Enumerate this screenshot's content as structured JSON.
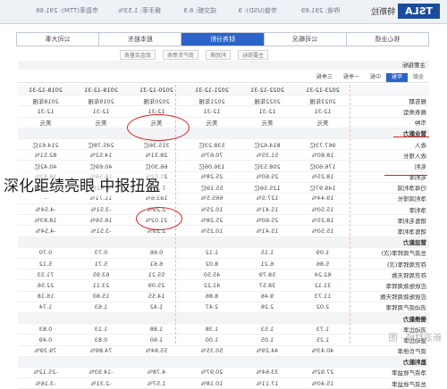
{
  "headline": "深化距绩亮眼 中报扭盈",
  "topbar": {
    "ticker": "TSLA",
    "tag": "特斯拉",
    "stats": [
      "昨收: 291.69",
      "市值(USD): 9",
      "成交额: 8.9",
      "换手率: 1.53%",
      "市盈率(TTM): 291.66"
    ]
  },
  "tabs": [
    "核心业绩",
    "公司概况",
    "财务分析",
    "股本股东",
    "公司大事"
  ],
  "active_tab": 2,
  "subtabs": [
    "主要指标",
    "利润表",
    "资产负债表",
    "现金流量表"
  ],
  "section_title": "主要指标",
  "periods": [
    "全部",
    "年报",
    "中报",
    "一季报",
    "三季报"
  ],
  "active_period": 1,
  "columns": [
    "",
    "2023-12-31",
    "2022-12-31",
    "2021-12-31",
    "2020-12-31",
    "2019-12-31",
    "2018-12-31"
  ],
  "rows": [
    {
      "label": "报告期",
      "values": [
        "2023年报",
        "2022年报",
        "2021年报",
        "2020年报",
        "2019年报",
        "2018年报"
      ]
    },
    {
      "label": "报表类型",
      "values": [
        "12-31",
        "12-31",
        "12-31",
        "12-31",
        "12-31",
        "12-31"
      ]
    },
    {
      "label": "币种",
      "values": [
        "美元",
        "美元",
        "美元",
        "美元",
        "美元",
        "美元"
      ]
    },
    {
      "label": "营业能力",
      "group": true
    },
    {
      "label": "收入",
      "values": [
        "967.73亿",
        "814.62亿",
        "538.23亿",
        "315.36亿",
        "245.78亿",
        "214.61亿"
      ]
    },
    {
      "label": "收入增长",
      "values": [
        "18.80%",
        "51.35%",
        "70.67%",
        "28.31%",
        "14.52%",
        "82.51%"
      ]
    },
    {
      "label": "毛利",
      "values": [
        "176.60亿",
        "208.53亿",
        "136.06亿",
        "66.30亿",
        "40.69亿",
        "40.42亿"
      ]
    },
    {
      "label": "毛利率",
      "values": [
        "18.25%",
        "25.60%",
        "25.28%",
        "21.02%",
        "16.56%",
        "18.83%"
      ]
    },
    {
      "label": "归母净利润",
      "values": [
        "149.97亿",
        "125.56亿",
        "55.19亿",
        "7.21亿",
        "-8.62亿",
        "-9.76亿"
      ]
    },
    {
      "label": "净利润增长",
      "values": [
        "19.44%",
        "127.5%",
        "665.5%",
        "183.6%",
        "11.71%",
        "-"
      ]
    },
    {
      "label": "净利率",
      "values": [
        "15.50%",
        "15.41%",
        "10.25%",
        "2.29%",
        "-3.51%",
        "-4.54%"
      ]
    },
    {
      "label": "销售毛利率",
      "values": [
        "18.25%",
        "25.60%",
        "25.28%",
        "21.02%",
        "16.56%",
        "18.83%"
      ]
    },
    {
      "label": "销售净利率",
      "values": [
        "15.50%",
        "15.41%",
        "10.25%",
        "2.29%",
        "-3.51%",
        "-4.54%"
      ]
    },
    {
      "label": "营运能力",
      "group": true
    },
    {
      "label": "总资产周转率(次)",
      "values": [
        "1.09",
        "1.15",
        "1.12",
        "0.66",
        "0.73",
        "0.70"
      ]
    },
    {
      "label": "存货周转率(次)",
      "values": [
        "5.86",
        "6.21",
        "8.02",
        "6.61",
        "5.71",
        "5.12"
      ]
    },
    {
      "label": "存货周转天数",
      "values": [
        "62.24",
        "58.79",
        "45.50",
        "55.21",
        "63.95",
        "71.33"
      ]
    },
    {
      "label": "应收账款周转率",
      "values": [
        "31.12",
        "38.57",
        "41.22",
        "25.09",
        "23.11",
        "22.56"
      ]
    },
    {
      "label": "应收账款周转天数",
      "values": [
        "11.73",
        "9.46",
        "8.86",
        "14.55",
        "15.80",
        "16.18"
      ]
    },
    {
      "label": "流动资产周转率",
      "values": [
        "2.02",
        "2.26",
        "2.47",
        "1.42",
        "1.63",
        "1.74"
      ]
    },
    {
      "label": "偿债能力",
      "group": true
    },
    {
      "label": "流动比率",
      "values": [
        "1.73",
        "1.53",
        "1.38",
        "1.88",
        "1.13",
        "0.83"
      ]
    },
    {
      "label": "速动比率",
      "values": [
        "1.25",
        "1.05",
        "1.00",
        "1.60",
        "0.83",
        "0.49"
      ]
    },
    {
      "label": "资产负债率",
      "values": [
        "40.43%",
        "44.29%",
        "50.35%",
        "55.84%",
        "74.86%",
        "79.39%"
      ]
    },
    {
      "label": "盈利能力",
      "group": true
    },
    {
      "label": "净资产收益率",
      "values": [
        "27.92%",
        "33.64%",
        "20.97%",
        "4.78%",
        "-14.93%",
        "-25.12%"
      ]
    },
    {
      "label": "总资产收益率",
      "values": [
        "15.40%",
        "17.11%",
        "10.18%",
        "1.57%",
        "-2.31%",
        "-3.16%"
      ]
    }
  ],
  "watermark": "新浪财经 · 图",
  "colors": {
    "accent": "#2b63c8",
    "brand": "#1a4c9e",
    "annotation": "#e02020"
  }
}
